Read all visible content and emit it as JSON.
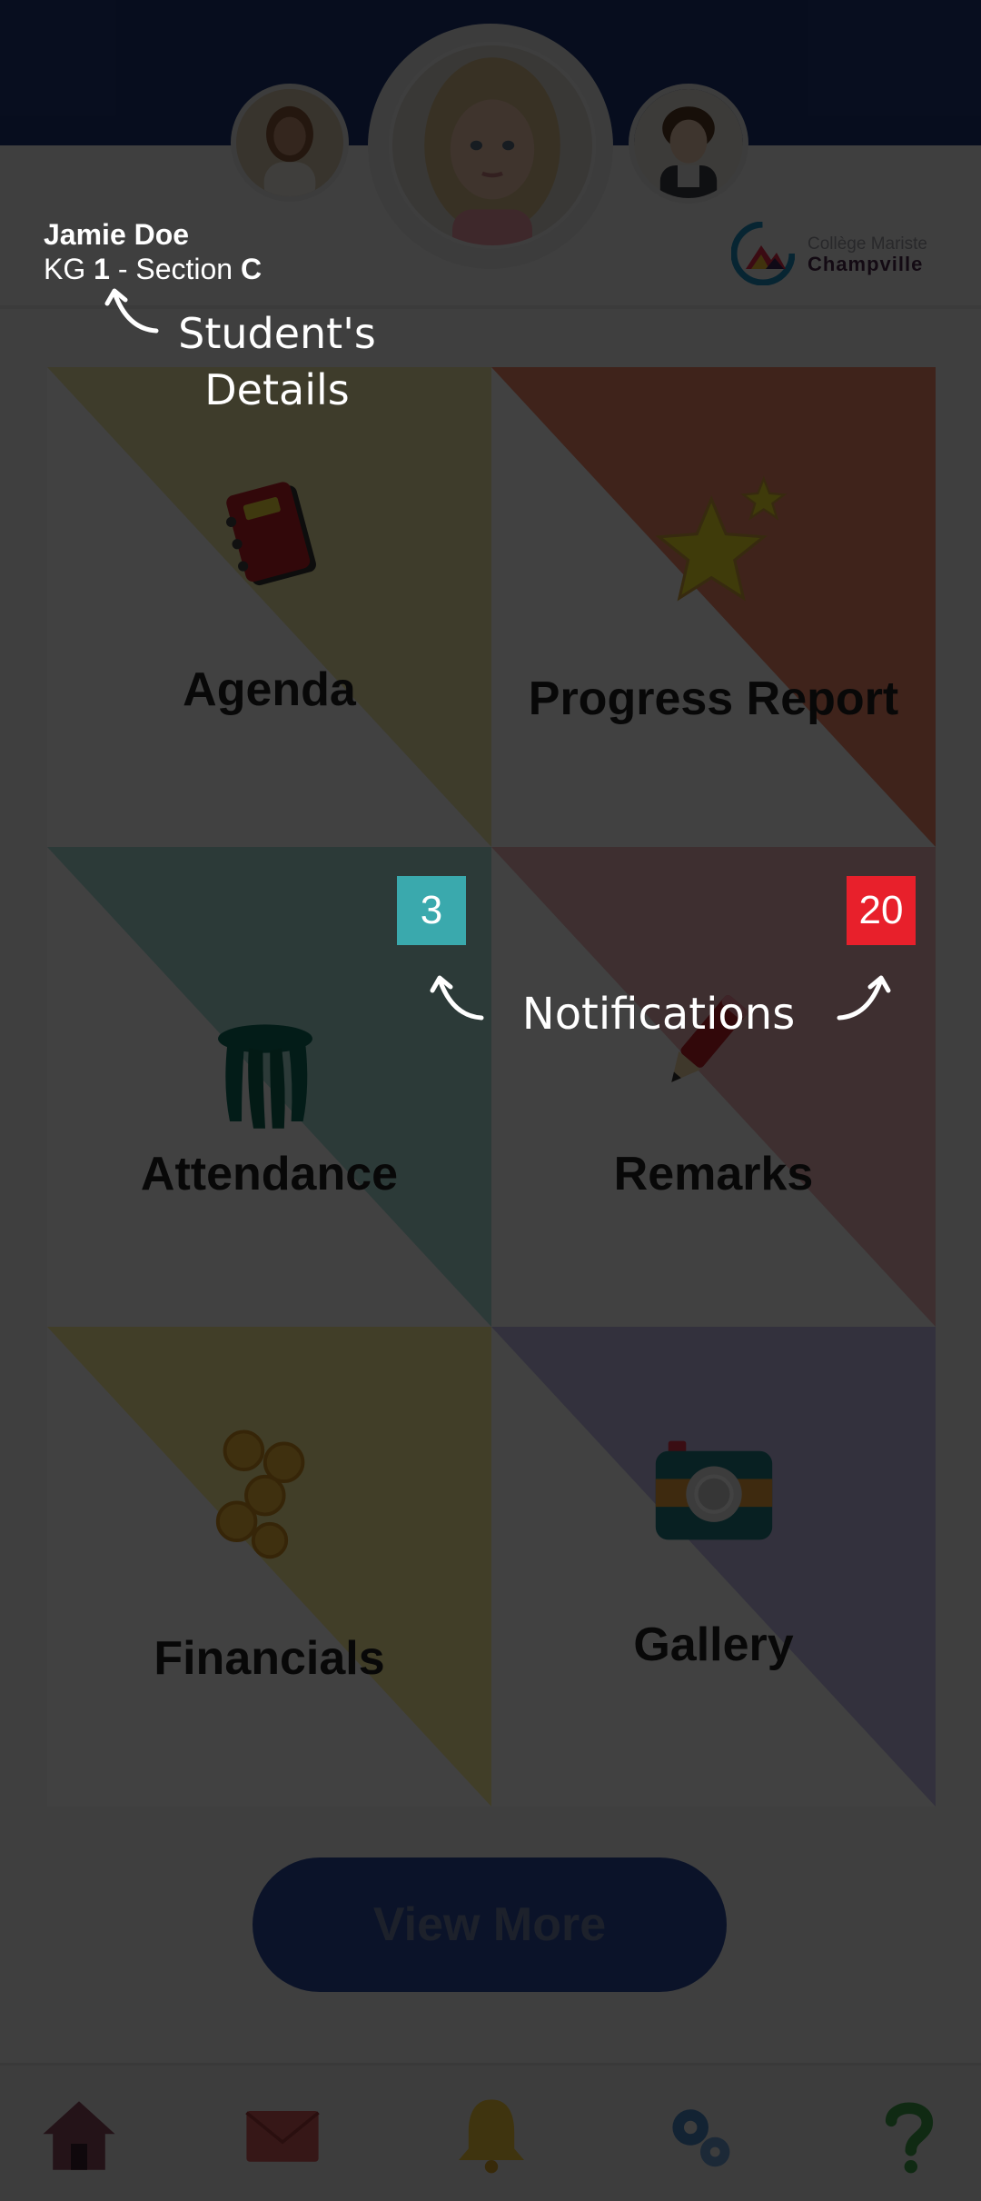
{
  "header": {
    "student_name": "Jamie Doe",
    "class_prefix": "KG ",
    "grade": "1",
    "section_prefix": " - Section ",
    "section": "C"
  },
  "logo": {
    "top_text": "Collège Mariste",
    "bottom_text": "Champville"
  },
  "tiles": [
    {
      "label": "Agenda",
      "icon": "agenda-book-icon",
      "accent": "#eee7a8"
    },
    {
      "label": "Progress Report",
      "icon": "star-icon",
      "accent": "#f3866a"
    },
    {
      "label": "Attendance",
      "icon": "stool-icon",
      "accent": "#a9ded9",
      "badge": "3",
      "badge_color": "#3aa9ad"
    },
    {
      "label": "Remarks",
      "icon": "pencil-icon",
      "accent": "#efb5b8",
      "badge": "20",
      "badge_color": "#e8202b"
    },
    {
      "label": "Financials",
      "icon": "coins-icon",
      "accent": "#fbf09a"
    },
    {
      "label": "Gallery",
      "icon": "camera-icon",
      "accent": "#c6bfeb"
    }
  ],
  "view_more_label": "View More",
  "bottom_nav": [
    {
      "icon": "home-icon"
    },
    {
      "icon": "envelope-icon"
    },
    {
      "icon": "bell-icon"
    },
    {
      "icon": "gears-icon"
    },
    {
      "icon": "help-icon"
    }
  ],
  "tutorial": {
    "details_hint": "Student's Details",
    "notifications_hint": "Notifications"
  },
  "colors": {
    "brand_blue": "#1e3576",
    "button_blue": "#2c4aa0",
    "overlay": "rgba(0,0,0,0.74)"
  }
}
